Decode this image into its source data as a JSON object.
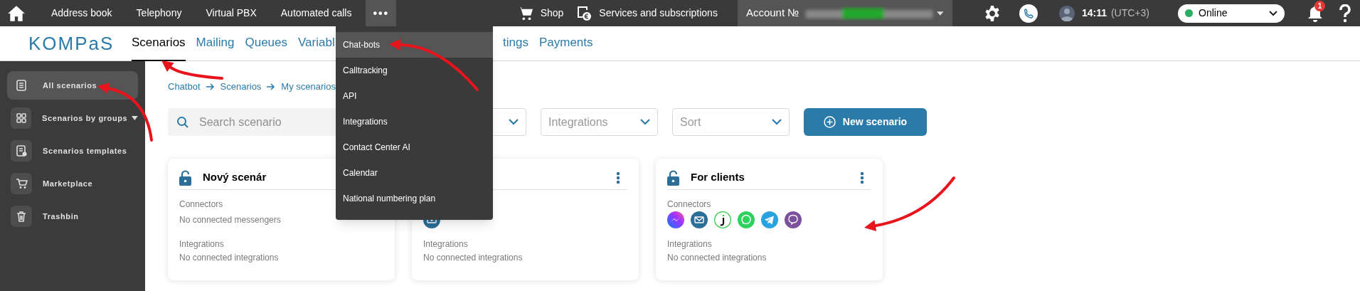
{
  "top_nav": {
    "items": [
      {
        "label": "Address book"
      },
      {
        "label": "Telephony"
      },
      {
        "label": "Virtual PBX"
      },
      {
        "label": "Automated calls"
      }
    ],
    "more": {
      "label": "•••",
      "expanded": true
    }
  },
  "top_right": {
    "shop": "Shop",
    "services": "Services and subscriptions",
    "account": "Account №",
    "time": "14:11",
    "timezone": "(UTC+3)",
    "status": "Online",
    "notifications": "1"
  },
  "logo": "KOMPaS",
  "tabs": [
    {
      "label": "Scenarios",
      "selected": true
    },
    {
      "label": "Mailing",
      "selected": false
    },
    {
      "label": "Queues",
      "selected": false
    },
    {
      "label": "Variabl",
      "selected": false
    },
    {
      "label": "tings",
      "selected": false
    },
    {
      "label": "Payments",
      "selected": false
    }
  ],
  "dropdown_menu": [
    {
      "label": "Chat-bots",
      "selected": true
    },
    {
      "label": "Calltracking",
      "selected": false
    },
    {
      "label": "API",
      "selected": false
    },
    {
      "label": "Integrations",
      "selected": false
    },
    {
      "label": "Contact Center AI",
      "selected": false
    },
    {
      "label": "Calendar",
      "selected": false
    },
    {
      "label": "National numbering plan",
      "selected": false
    }
  ],
  "sidebar": [
    {
      "label": "All scenarios",
      "kind": "list",
      "caret": false,
      "selected": true
    },
    {
      "label": "Scenarios by groups",
      "kind": "grid",
      "caret": true,
      "selected": false
    },
    {
      "label": "Scenarios templates",
      "kind": "template",
      "caret": false,
      "selected": false
    },
    {
      "label": "Marketplace",
      "kind": "cart",
      "caret": false,
      "selected": false
    },
    {
      "label": "Trashbin",
      "kind": "trash",
      "caret": false,
      "selected": false
    }
  ],
  "breadcrumbs": [
    "Chatbot",
    "Scenarios",
    "My scenarios"
  ],
  "search": {
    "placeholder": "Search scenario"
  },
  "selects": [
    {
      "kind": "select"
    },
    {
      "kind": "select",
      "placeholder": "Integrations"
    },
    {
      "kind": "select",
      "placeholder": "Sort"
    }
  ],
  "new_button": "New scenario",
  "cards": [
    {
      "title": "Nový scenár",
      "menu": false,
      "connectors_label": "Connectors",
      "connectors_text": "No connected messengers",
      "integrations_label": "Integrations",
      "integrations_text": "No connected integrations"
    },
    {
      "menu": true,
      "connectors": [
        {
          "kind": "email"
        }
      ],
      "integrations_label": "Integrations",
      "integrations_text": "No connected integrations"
    },
    {
      "title": "For clients",
      "menu": true,
      "connectors_label": "Connectors",
      "connectors": [
        {
          "kind": "messenger"
        },
        {
          "kind": "email"
        },
        {
          "kind": "jivo"
        },
        {
          "kind": "whatsapp"
        },
        {
          "kind": "telegram"
        },
        {
          "kind": "viber"
        }
      ],
      "integrations_label": "Integrations",
      "integrations_text": "No connected integrations"
    }
  ]
}
